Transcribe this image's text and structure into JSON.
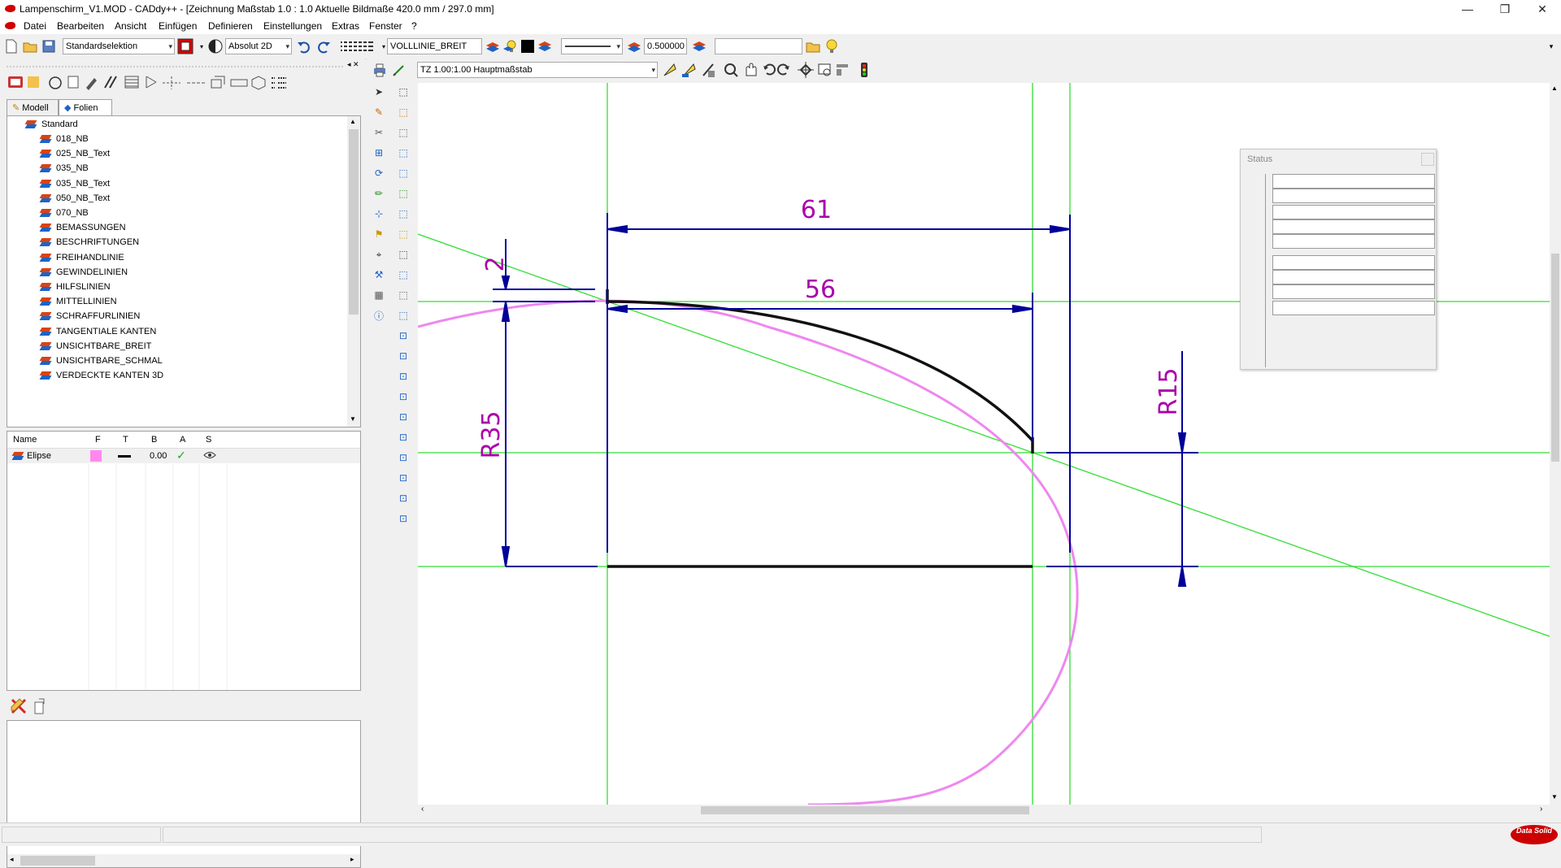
{
  "window": {
    "title": "Lampenschirm_V1.MOD  -  CADdy++ - [Zeichnung   Maßstab 1.0 : 1.0   Aktuelle Bildmaße 420.0 mm / 297.0 mm]",
    "controls": {
      "minimize": "—",
      "restore": "❐",
      "close": "✕"
    }
  },
  "menu": [
    "Datei",
    "Bearbeiten",
    "Ansicht",
    "Einfügen",
    "Definieren",
    "Einstellungen",
    "Extras",
    "Fenster",
    "?"
  ],
  "toolbar": {
    "selection_mode": "Standardselektion",
    "coordinate_mode": "Absolut 2D",
    "line_type": "VOLLLINIE_BREIT",
    "line_width": "0.500000",
    "search_value": ""
  },
  "view_toolbar": {
    "scale": "TZ 1.00:1.00 Hauptmaßstab"
  },
  "left_panel": {
    "tabs": [
      "Modell",
      "Folien"
    ],
    "active_tab": "Folien",
    "tree": {
      "root": "Standard",
      "items": [
        "018_NB",
        "025_NB_Text",
        "035_NB",
        "035_NB_Text",
        "050_NB_Text",
        "070_NB",
        "BEMASSUNGEN",
        "BESCHRIFTUNGEN",
        "FREIHANDLINIE",
        "GEWINDELINIEN",
        "HILFSLINIEN",
        "MITTELLINIEN",
        "SCHRAFFURLINIEN",
        "TANGENTIALE KANTEN",
        "UNSICHTBARE_BREIT",
        "UNSICHTBARE_SCHMAL",
        "VERDECKTE KANTEN 3D"
      ]
    },
    "layer_table": {
      "columns": [
        "Name",
        "F",
        "T",
        "B",
        "A",
        "S"
      ],
      "rows": [
        {
          "name": "Elipse",
          "color": "#ff88ee",
          "width": "0.00"
        }
      ]
    }
  },
  "drawing": {
    "dimensions": [
      "61",
      "56",
      "2",
      "R35",
      "R15"
    ],
    "colors": {
      "construction": "#33dd33",
      "dimension": "#000099",
      "dimension_text": "#aa00aa",
      "contour": "#111111",
      "ellipse": "#ee88ee"
    }
  },
  "status_window": {
    "title": "Status",
    "rows": 9
  },
  "brand": "Data Solid"
}
